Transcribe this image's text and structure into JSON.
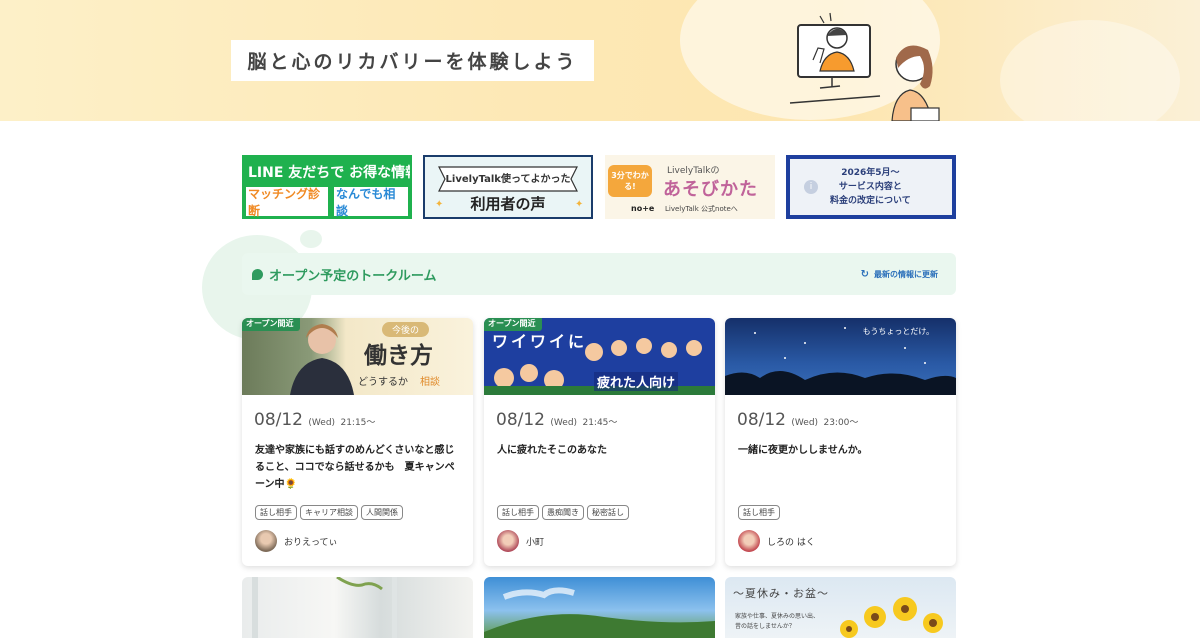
{
  "hero": {
    "title": "脳と心のリカバリーを体験しよう"
  },
  "banners": {
    "line": {
      "title": "LINE 友だちで お得な情報",
      "btn1": "マッチング診断",
      "btn2": "なんでも相談"
    },
    "voice": {
      "top": "LivelyTalk使ってよかった",
      "main": "利用者の声"
    },
    "note": {
      "badge": "3分でわかる!",
      "top": "LivelyTalkの",
      "main": "あそびかた",
      "brand": "no+e",
      "sub": "LivelyTalk 公式noteへ"
    },
    "notice": {
      "date": "2026年5月〜",
      "line1": "サービス内容と",
      "line2": "料金の改定について"
    }
  },
  "section": {
    "title": "オープン予定のトークルーム",
    "refresh": "最新の情報に更新"
  },
  "cards": [
    {
      "badge": "オープン間近",
      "img_text1": "今後の",
      "img_text2": "働き方",
      "img_text3": "どうするか",
      "img_text4": "相談",
      "date": "08/12",
      "weekday": "(Wed)",
      "time": "21:15〜",
      "desc": "友達や家族にも話すのめんどくさいなと感じること、ココでなら話せるかも　夏キャンペーン中🌻",
      "tags": [
        "話し相手",
        "キャリア相談",
        "人間関係"
      ],
      "host": "おりえってぃ"
    },
    {
      "badge": "オープン間近",
      "img_text1": "ワイワイに",
      "img_text2": "疲れた人向け",
      "date": "08/12",
      "weekday": "(Wed)",
      "time": "21:45〜",
      "desc": "人に疲れたそこのあなた",
      "tags": [
        "話し相手",
        "愚痴聞き",
        "秘密話し"
      ],
      "host": "小町"
    },
    {
      "img_text1": "もうちょっとだけ。",
      "date": "08/12",
      "weekday": "(Wed)",
      "time": "23:00〜",
      "desc": "一緒に夜更かししませんか。",
      "tags": [
        "話し相手"
      ],
      "host": "しろの はく"
    }
  ],
  "bottom_cards": [
    {
      "img_text1": ""
    },
    {
      "img_text1": ""
    },
    {
      "img_text1": "〜夏休み・お盆〜",
      "img_text2": "家族や仕事、夏休みの思い出、",
      "img_text3": "昔の話をしませんか？"
    }
  ],
  "colors": {
    "accent_green": "#2f9b5f",
    "badge_green": "#2a8f53",
    "line_green": "#1fb14e",
    "link_blue": "#2a6fba"
  }
}
